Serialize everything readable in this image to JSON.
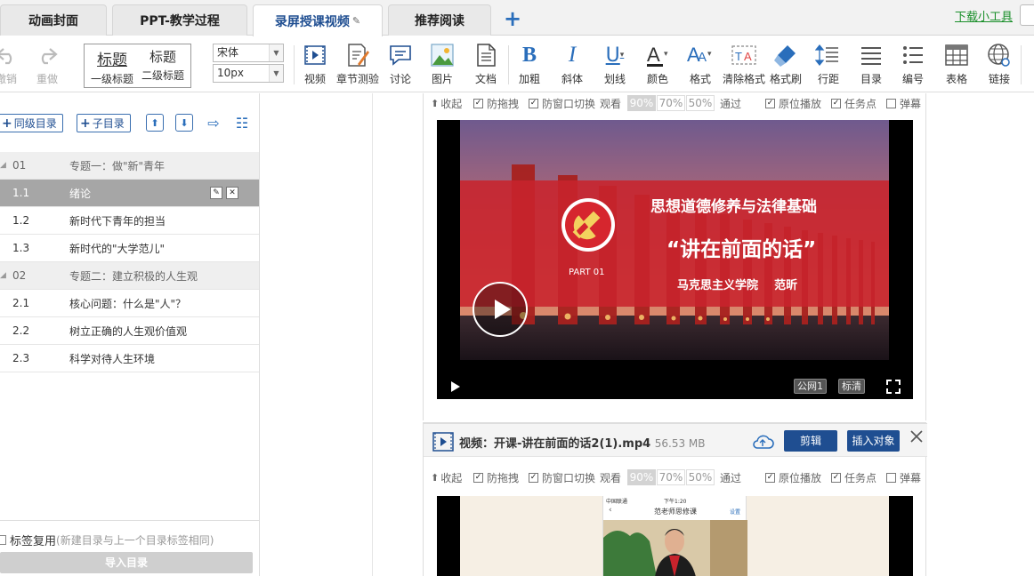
{
  "tabs": [
    {
      "label": "动画封面"
    },
    {
      "label": "PPT-教学过程"
    },
    {
      "label": "录屏授课视频"
    },
    {
      "label": "推荐阅读"
    }
  ],
  "tab_add": "+",
  "download_tool": "下载小工具",
  "toolbar": {
    "undo": "撤销",
    "redo": "重做",
    "heading1_big": "标题",
    "heading1_small": "一级标题",
    "heading2_big": "标题",
    "heading2_small": "二级标题",
    "font_family": "宋体",
    "font_size": "10px",
    "video": "视频",
    "quiz": "章节测验",
    "discuss": "讨论",
    "image": "图片",
    "doc": "文档",
    "bold": "加粗",
    "italic": "斜体",
    "underline": "划线",
    "color": "颜色",
    "format": "格式",
    "clear_format": "清除格式",
    "format_brush": "格式刷",
    "line_spacing": "行距",
    "toc": "目录",
    "numbering": "编号",
    "table": "表格",
    "link": "链接"
  },
  "left_panel": {
    "same_level_btn": "同级目录",
    "child_btn": "子目录",
    "items": [
      {
        "num": "01",
        "title": "专题一：做\"新\"青年",
        "type": "chapter"
      },
      {
        "num": "1.1",
        "title": "绪论",
        "type": "selected"
      },
      {
        "num": "1.2",
        "title": "新时代下青年的担当",
        "type": "item"
      },
      {
        "num": "1.3",
        "title": "新时代的\"大学范儿\"",
        "type": "item"
      },
      {
        "num": "02",
        "title": "专题二：建立积极的人生观",
        "type": "chapter"
      },
      {
        "num": "2.1",
        "title": "核心问题：什么是\"人\"？",
        "type": "item"
      },
      {
        "num": "2.2",
        "title": "树立正确的人生观价值观",
        "type": "item"
      },
      {
        "num": "2.3",
        "title": "科学对待人生环境",
        "type": "item"
      }
    ],
    "tag_reuse_label": "标签复用",
    "tag_reuse_hint": "(新建目录与上一个目录标签相同)",
    "import_btn": "导入目录"
  },
  "video_options": {
    "collapse": "收起",
    "anti_drag": "防拖拽",
    "anti_window_switch": "防窗口切换",
    "watch": "观看",
    "pcts": [
      "90%",
      "70%",
      "50%"
    ],
    "pass": "通过",
    "inplace_play": "原位播放",
    "task_point": "任务点",
    "danmaku": "弹幕"
  },
  "video1": {
    "slide_title": "思想道德修养与法律基础",
    "slide_subtitle": "“讲在前面的话”",
    "slide_part": "PART 01",
    "slide_author": "马克思主义学院    范昕",
    "line_btn": "公网1",
    "quality_btn": "标清"
  },
  "video2": {
    "title": "视频：开课-讲在前面的话2(1).mp4",
    "size": "56.53 MB",
    "edit_btn": "剪辑",
    "insert_btn": "插入对象",
    "phone_title": "范老师思修课",
    "phone_status_left": "中国联通",
    "phone_status_time": "下午1:20",
    "phone_action": "设置"
  },
  "colors": {
    "accent_blue": "#1f4e91",
    "link_green": "#1a8f2a",
    "slide_red": "#c8232c"
  }
}
